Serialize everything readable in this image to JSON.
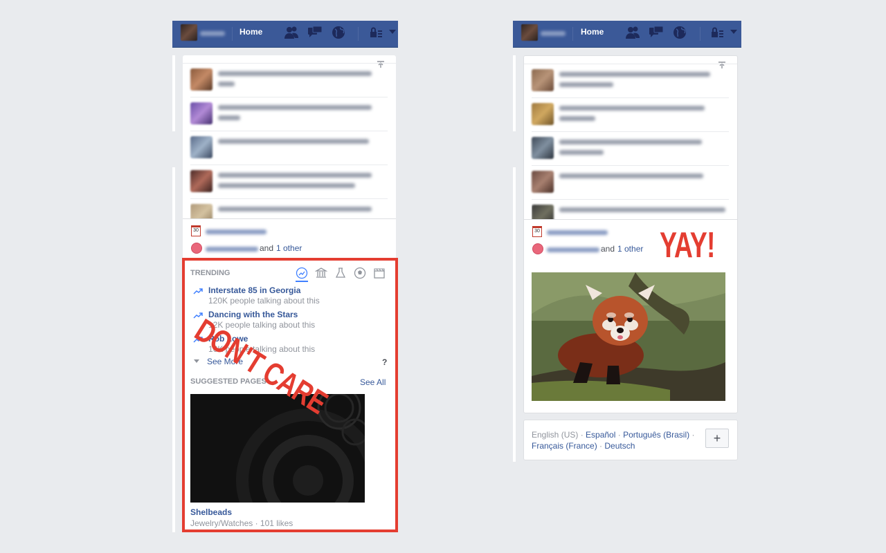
{
  "left_panel": {
    "topbar": {
      "home_label": "Home"
    },
    "birthday_suffix": "and",
    "birthday_other": "1 other",
    "trending": {
      "label": "TRENDING",
      "items": [
        {
          "title": "Interstate 85 in Georgia",
          "meta": "120K people talking about this"
        },
        {
          "title": "Dancing with the Stars",
          "meta": "12K people talking about this"
        },
        {
          "title": "Rob Lowe",
          "meta": "16K people talking about this"
        }
      ],
      "see_more": "See More",
      "help": "?"
    },
    "suggested": {
      "label": "SUGGESTED PAGES",
      "see_all": "See All",
      "page_name": "Shelbeads",
      "page_meta": "Jewelry/Watches · 101 likes"
    },
    "stamp": "DON'T CARE"
  },
  "right_panel": {
    "topbar": {
      "home_label": "Home"
    },
    "birthday_suffix": "and",
    "birthday_other": "1 other",
    "stamp": "YAY!",
    "languages": {
      "current": "English (US)",
      "line1": [
        "Español",
        "Português (Brasil)"
      ],
      "line2": [
        "Français (France)",
        "Deutsch"
      ],
      "sep": " · "
    },
    "add_label": "+"
  },
  "calendar_day": "30",
  "colors": {
    "brand": "#3b5998",
    "link": "#365899",
    "highlight": "#e43d31",
    "trend": "#4080ff"
  }
}
